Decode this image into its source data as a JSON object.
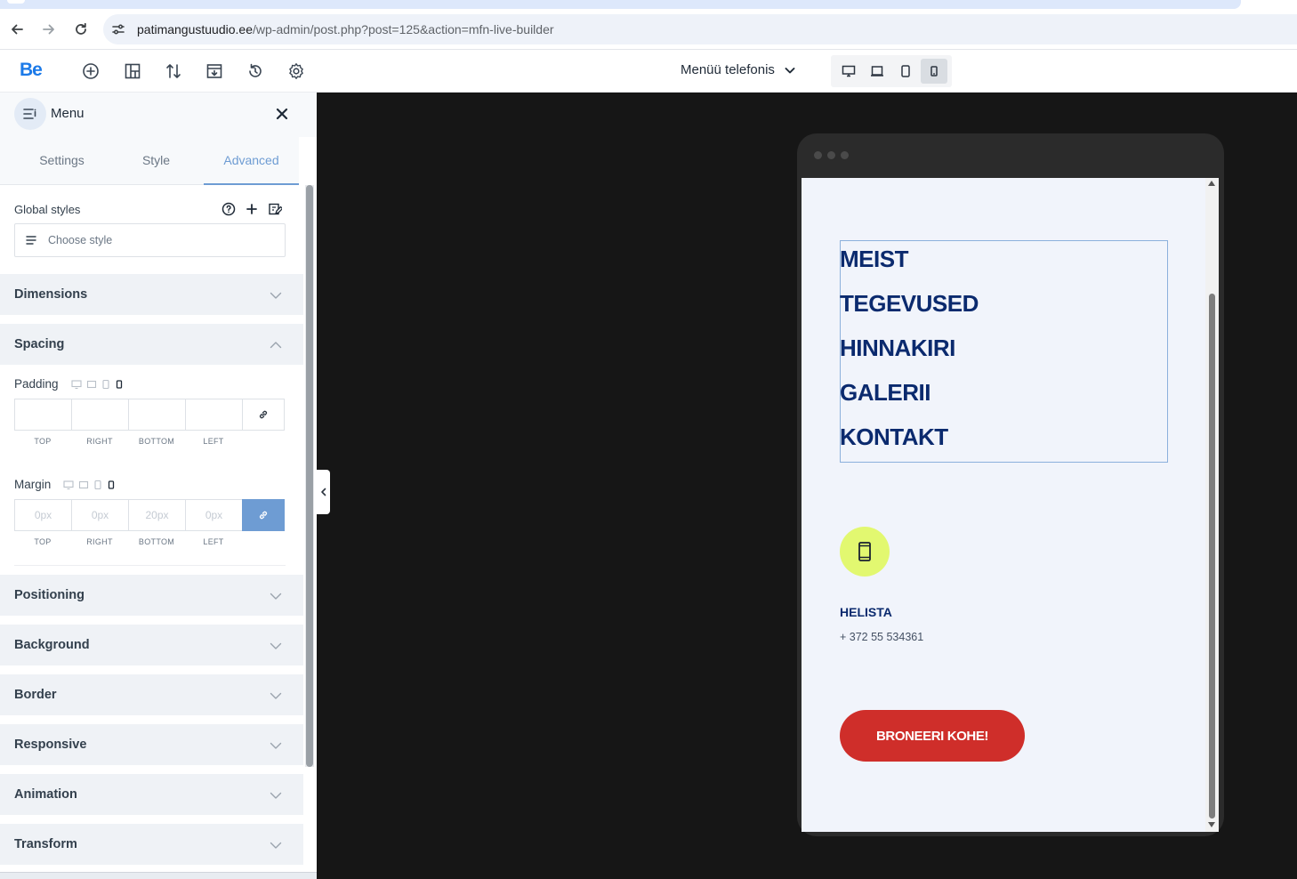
{
  "browser": {
    "url_host": "patimangustuudio.ee",
    "url_path": "/wp-admin/post.php?post=125&action=mfn-live-builder"
  },
  "toolbar": {
    "logo": "Be",
    "view_select": "Menüü telefonis",
    "icons": [
      "add-icon",
      "layout-icon",
      "sort-icon",
      "template-icon",
      "history-icon",
      "settings-icon"
    ],
    "devices": [
      "desktop",
      "laptop",
      "tablet",
      "mobile"
    ],
    "active_device": "mobile",
    "accent_color": "#1c7ae8"
  },
  "panel": {
    "title": "Menu",
    "tabs": [
      {
        "label": "Settings"
      },
      {
        "label": "Style"
      },
      {
        "label": "Advanced"
      }
    ],
    "active_tab": "Advanced",
    "global_styles": {
      "label": "Global styles",
      "placeholder": "Choose style"
    },
    "sections": {
      "dimensions": "Dimensions",
      "spacing": "Spacing",
      "positioning": "Positioning",
      "background": "Background",
      "border": "Border",
      "responsive": "Responsive",
      "animation": "Animation",
      "transform": "Transform"
    },
    "padding": {
      "label": "Padding",
      "values": [
        "",
        "",
        "",
        ""
      ],
      "captions": [
        "TOP",
        "RIGHT",
        "BOTTOM",
        "LEFT"
      ]
    },
    "margin": {
      "label": "Margin",
      "values": [
        "0px",
        "0px",
        "20px",
        "0px"
      ],
      "captions": [
        "TOP",
        "RIGHT",
        "BOTTOM",
        "LEFT"
      ]
    }
  },
  "preview": {
    "menu_items": [
      "MEIST",
      "TEGEVUSED",
      "HINNAKIRI",
      "GALERII",
      "KONTAKT"
    ],
    "contact_title": "HELISTA",
    "contact_phone": "+ 372 55 534361",
    "cta_label": "BRONEERI KOHE!",
    "colors": {
      "menu_text": "#0b2a6e",
      "phone_circle": "#e2f870",
      "cta_bg": "#cf2e2a",
      "screen_bg": "#f1f4fb"
    }
  }
}
